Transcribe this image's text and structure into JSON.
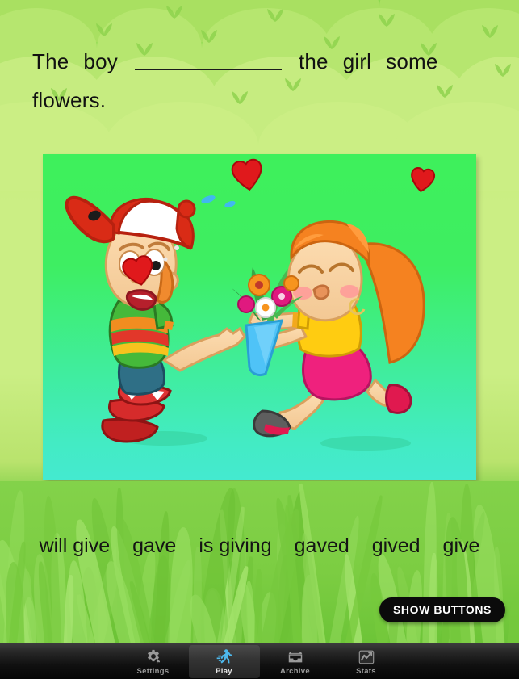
{
  "app": {
    "background_top": "#8ed94f",
    "background_mid": "#cbee84",
    "grass": "#7ccd42"
  },
  "sentence": {
    "words_line1": [
      "The",
      "boy"
    ],
    "blank": "____________",
    "words_line1_after": [
      "the",
      "girl",
      "some"
    ],
    "line2": "flowers."
  },
  "illustration": {
    "card_bg_top": "#3ef05b",
    "card_bg_bottom": "#44ead0",
    "alt": "Cartoon boy with backwards red and white cap reaching toward a girl with orange hair who holds a blue bouquet of flowers, red hearts floating above",
    "hearts_color": "#e0191c",
    "boy": {
      "cap_color": "#d92b16",
      "cap_panel": "#ffffff",
      "hair": "#f08a2e",
      "shirt_stripes": [
        "#45b93a",
        "#f18d20",
        "#e2372a",
        "#45b93a"
      ],
      "shorts": "#2f6f86",
      "shoes": "#d62b2b"
    },
    "girl": {
      "hair": "#f58220",
      "top": "#ffcc11",
      "skirt": "#ef217d",
      "shoe_left": "#5e5e5e",
      "shoe_right": "#e0194f",
      "bouquet_wrap": "#4fc3f7",
      "flowers": [
        "#f7941e",
        "#e0197f",
        "#ffffff",
        "#e0197f"
      ]
    }
  },
  "options": {
    "items": [
      {
        "label": "will give"
      },
      {
        "label": "gave"
      },
      {
        "label": "is giving"
      },
      {
        "label": "gaved"
      },
      {
        "label": "gived"
      },
      {
        "label": "give"
      }
    ]
  },
  "show_buttons": {
    "label": "Show Buttons"
  },
  "tabbar": {
    "items": [
      {
        "label": "Settings",
        "icon": "gear-icon",
        "active": false
      },
      {
        "label": "Play",
        "icon": "runner-icon",
        "active": true
      },
      {
        "label": "Archive",
        "icon": "tray-icon",
        "active": false
      },
      {
        "label": "Stats",
        "icon": "chart-icon",
        "active": false
      }
    ],
    "active_color": "#4db8ec"
  }
}
